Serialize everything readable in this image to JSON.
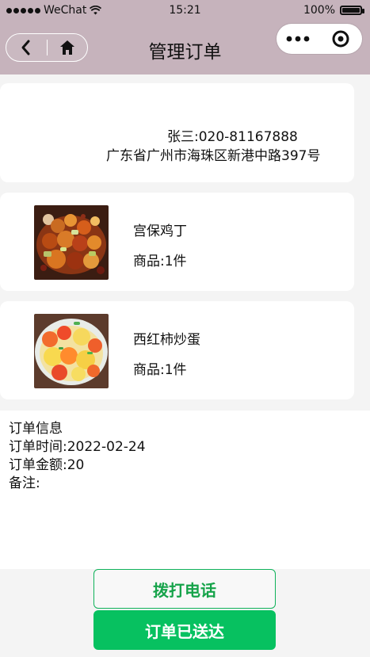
{
  "status_bar": {
    "carrier": "WeChat",
    "time": "15:21",
    "battery": "100%",
    "icons": {
      "signal": "signal-dots-icon",
      "wifi": "wifi-icon",
      "battery": "battery-icon"
    }
  },
  "nav": {
    "title": "管理订单",
    "back_icon": "chevron-left-icon",
    "home_icon": "home-icon",
    "more_icon": "more-dots-icon",
    "mini_program_icon": "target-circle-icon"
  },
  "address": {
    "name_phone": "张三:020-81167888",
    "address": "广东省广州市海珠区新港中路397号"
  },
  "items": [
    {
      "name": "宫保鸡丁",
      "quantity": "商品:1件",
      "image": "kung-pao-chicken-image"
    },
    {
      "name": "西红柿炒蛋",
      "quantity": "商品:1件",
      "image": "tomato-egg-image"
    }
  ],
  "order": {
    "title": "订单信息",
    "time_label": "订单时间:",
    "time_value": "2022-02-24",
    "amount_label": "订单金额:",
    "amount_value": "20",
    "remark_label": "备注:"
  },
  "buttons": {
    "call": "拨打电话",
    "delivered": "订单已送达"
  },
  "colors": {
    "header_bg": "#c6b3bc",
    "primary_green": "#07c160",
    "call_green": "#16a34a",
    "background": "#f4f4f4"
  }
}
